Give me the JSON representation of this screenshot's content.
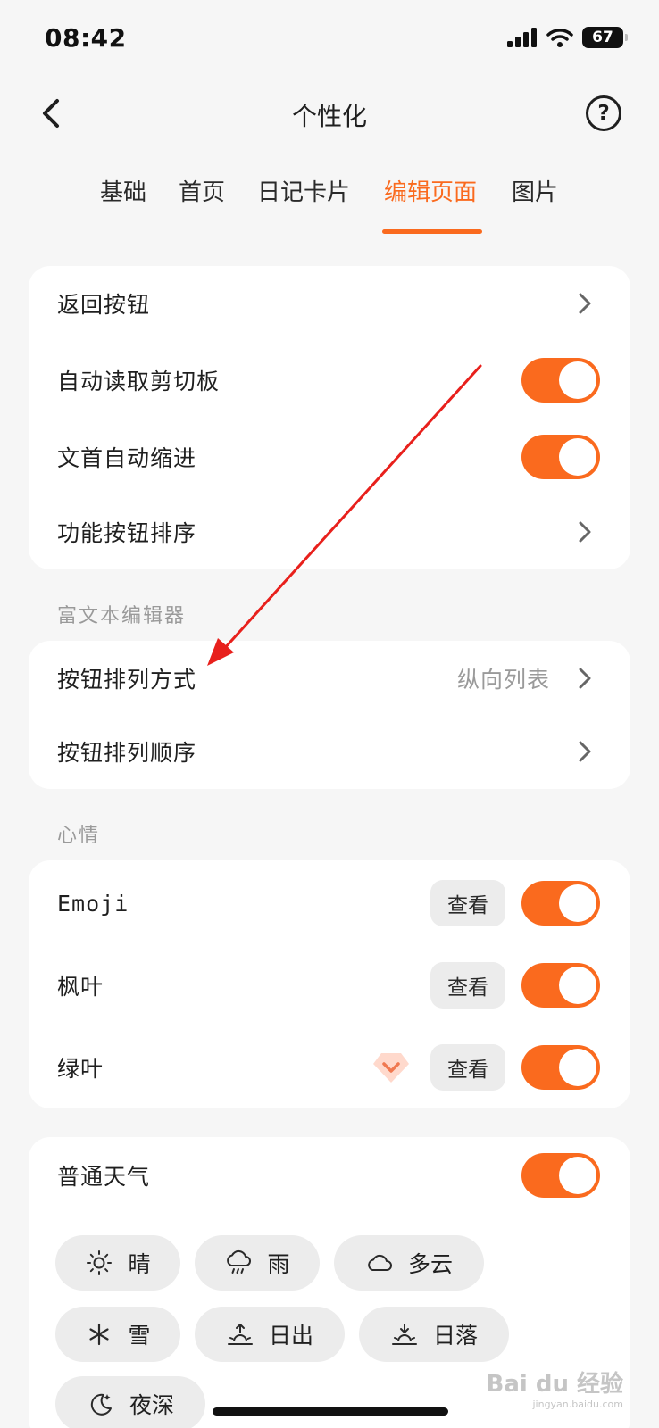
{
  "status_bar": {
    "time": "08:42",
    "battery": "67"
  },
  "nav": {
    "title": "个性化"
  },
  "tabs": [
    {
      "label": "基础"
    },
    {
      "label": "首页"
    },
    {
      "label": "日记卡片"
    },
    {
      "label": "编辑页面"
    },
    {
      "label": "图片"
    }
  ],
  "general": {
    "back_button": "返回按钮",
    "auto_clipboard": "自动读取剪切板",
    "auto_indent": "文首自动缩进",
    "button_order": "功能按钮排序"
  },
  "rich_text": {
    "section_title": "富文本编辑器",
    "arrangement_label": "按钮排列方式",
    "arrangement_value": "纵向列表",
    "sequence_label": "按钮排列顺序"
  },
  "mood": {
    "section_title": "心情",
    "items": [
      {
        "label": "Emoji",
        "view": "查看"
      },
      {
        "label": "枫叶",
        "view": "查看"
      },
      {
        "label": "绿叶",
        "view": "查看"
      }
    ]
  },
  "weather": {
    "label": "普通天气",
    "chips": [
      {
        "label": "晴",
        "icon": "sun-icon"
      },
      {
        "label": "雨",
        "icon": "rain-icon"
      },
      {
        "label": "多云",
        "icon": "cloud-icon"
      },
      {
        "label": "雪",
        "icon": "snow-icon"
      },
      {
        "label": "日出",
        "icon": "sunrise-icon"
      },
      {
        "label": "日落",
        "icon": "sunset-icon"
      },
      {
        "label": "夜深",
        "icon": "moon-icon"
      }
    ]
  },
  "watermark": {
    "text": "Bai du 经验",
    "sub": "jingyan.baidu.com"
  },
  "colors": {
    "accent": "#fa6a1e",
    "background": "#f6f6f6",
    "card": "#ffffff",
    "chip": "#ececec",
    "annotation": "#e8201c"
  }
}
